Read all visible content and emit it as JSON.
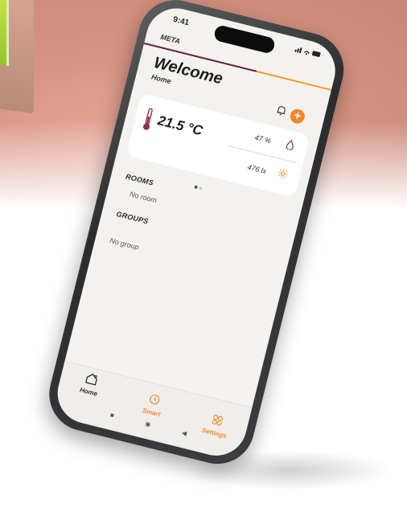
{
  "status_bar": {
    "time": "9:41",
    "icons": "……ll ◔ ▬"
  },
  "app": {
    "name": "META"
  },
  "welcome": {
    "title": "Welcome",
    "subtitle": "Home"
  },
  "sensor_card": {
    "temperature": "21.5 °C",
    "humidity": "47 %",
    "illuminance": "476 lx"
  },
  "rooms": {
    "label": "ROOMS",
    "empty_text": "No room"
  },
  "groups": {
    "label": "GROUPS",
    "empty_text": "No group"
  },
  "tabbar": {
    "tabs": [
      {
        "label": "Home",
        "icon": "home-icon",
        "active": true
      },
      {
        "label": "Smart",
        "icon": "smart-icon",
        "active": false
      },
      {
        "label": "Settings",
        "icon": "settings-icon",
        "active": false
      }
    ]
  },
  "colors": {
    "accent_orange": "#f08a26",
    "brand_plum": "#6b1f46",
    "active_tab": "#2a2a2a",
    "inactive_tab": "#f08a26"
  }
}
